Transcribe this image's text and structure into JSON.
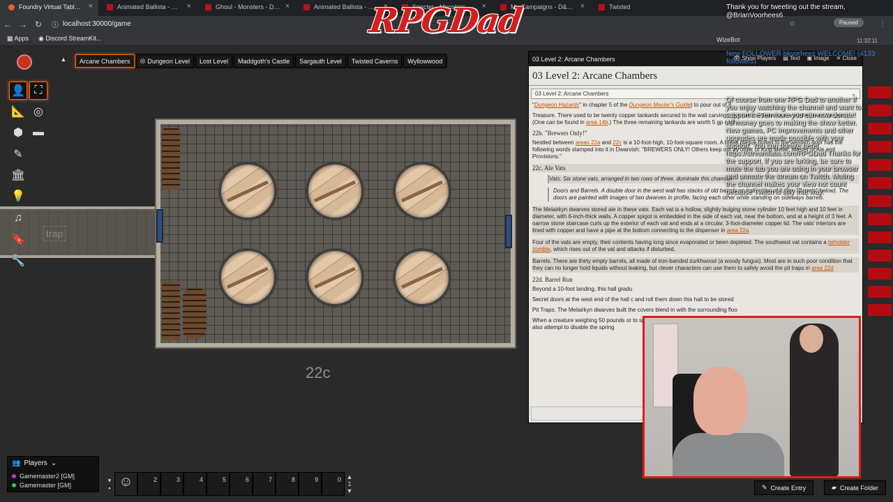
{
  "browser": {
    "tabs": [
      {
        "title": "Foundry Virtual Tabletop • A",
        "active": true
      },
      {
        "title": "Animated Ballista - Monste"
      },
      {
        "title": "Ghoul - Monsters - D&D Be"
      },
      {
        "title": "Animated Ballista - Monste"
      },
      {
        "title": "Specter - Monsters - D&D B"
      },
      {
        "title": "My Campaigns - D&D Beyo"
      },
      {
        "title": "Twisted"
      }
    ],
    "url": "localhost:30000/game",
    "bookmarks": [
      "Apps",
      "Discord StreamKit..."
    ],
    "profile_status": "Paused"
  },
  "overlay": {
    "logo": "RPGDad",
    "tweet": "Thank you for tweeting out the stream, @BrianVoorhees6.",
    "wizebot": "WizeBot",
    "clock": "11:32:11",
    "chat_message": "Of course from one RPG Dad to another If you enjoy watching the channel and want to support it even more you can now donate! All money goes to making the show better. New games, PC improvements and other upgrades are made possible with your support. You can donate here! https://streamlabs.com/RPGDad Thanks for the support. If you are lurking, be sure to mute the tab you are using in your browser and unmute the stream on Twitch. Muting the channel makes your view not count because Twitch is silly that way.",
    "follower_banner": "New FOLLOWER bkyorheez WELCOME! (4133 followers)"
  },
  "scene_nav": {
    "scenes": [
      {
        "label": "Arcane Chambers",
        "active": true
      },
      {
        "label": "Dungeon Level",
        "icon": "compass"
      },
      {
        "label": "Lost Level"
      },
      {
        "label": "Maddgoth's Castle"
      },
      {
        "label": "Sargauth Level"
      },
      {
        "label": "Twisted Caverns"
      },
      {
        "label": "Wyllowwood"
      }
    ]
  },
  "map": {
    "room_label": "22c",
    "trap_label": "trap"
  },
  "controls": [
    "token",
    "fullscreen",
    "measure",
    "target",
    "tiles",
    "draw",
    "walls",
    "lighting",
    "sounds",
    "notes",
    "settings"
  ],
  "players": {
    "header": "Players",
    "list": [
      {
        "name": "Gamemaster2 [GM]",
        "color": "#c43cc4"
      },
      {
        "name": "Gamemaster [GM]",
        "color": "#2ecc40"
      }
    ]
  },
  "hotbar": {
    "slots": [
      "1",
      "2",
      "3",
      "4",
      "5",
      "6",
      "7",
      "8",
      "9",
      "0"
    ],
    "page": "1"
  },
  "journal": {
    "window_title": "03 Level 2: Arcane Chambers",
    "heading": "03 Level 2: Arcane Chambers",
    "selected_page": "03 Level 2: Arcane Chambers",
    "header_buttons": [
      "Show Players",
      "Text",
      "Image",
      "Close"
    ],
    "para1_pre": "\"",
    "para1_link": "Dungeon Hazards",
    "para1_mid": "\" in chapter 5 of the ",
    "para1_link2": "Dungeon Master's Guide",
    "para1_post": ") to pour out of it.",
    "treasure": "Treasure. There used to be twenty copper tankards secured to the wall carvings, but most of them have vanished over the years. (One can be found in ",
    "treasure_link": "area 14b",
    "treasure_post": ".) The three remaining tankards are worth 5 gp each.",
    "h22b": "22b. \"Brewers Only!\"",
    "p22b_pre": "Nestled between ",
    "p22b_link1": "areas 22a",
    "p22b_and": " and ",
    "p22b_link2": "22c",
    "p22b_post": " is a 10-foot-high, 10-foot-square room. A brass plaque bolted to the western door has the following words stamped into it in Dwarvish: \"BREWERS ONLY! Others keep out by order of King Melair, Master of Ale and Provisions.\"",
    "h22c": "22c. Ale Vats",
    "q1": "Vats. Six stone vats, arranged in two rows of three, dominate this chamber.",
    "q2": "Doors and Barrels. A double door in the west wall has stacks of old barrels on both sides of it (see \"Barrels\" below). The doors are painted with images of two dwarves in profile, facing each other while standing on sideways barrels.",
    "p_vats": "The Melairkyn dwarves stored ale in these vats. Each vat is a hollow, slightly bulging stone cylinder 10 feet high and 10 feet in diameter, with 6-inch-thick walls. A copper spigot is embedded in the side of each vat, near the bottom, and at a height of 3 feet. A narrow stone staircase curls up the exterior of each vat and ends at a circular, 3-foot-diameter copper lid. The vats' interiors are lined with copper and have a pipe at the bottom connecting to the dispenser in ",
    "p_vats_link": "area 22a",
    "p_empty_pre": "Four of the vats are empty, their contents having long since evaporated or been depleted. The southwest vat contains a ",
    "p_empty_link": "beholder zombie",
    "p_empty_post": ", which rises out of the vat and attacks if disturbed.",
    "barrels": "Barrels. There are thirty empty barrels, all made of iron-banded zurkhwood (a woody fungus). Most are in such poor condition that they can no longer hold liquids without leaking, but clever characters can use them to safely avoid the pit traps in ",
    "barrels_link": "area 22d",
    "h22d": "22d. Barrel Run",
    "p22d": "Beyond a 10-foot landing, this hall gradu",
    "secret": "Secret doors at the west end of the hall c and roll them down this hall to be stored",
    "pit": "Pit Traps. The Melairkyn dwarves built the covers blend in with the surrounding floo",
    "creature": "When a creature weighing 50 pounds or to spill into the pit below and take 2d6 bl after the creature falls through. A succes pit can also attempt to disable the spring"
  },
  "buttons": {
    "create_entry": "Create Entry",
    "create_folder": "Create Folder"
  },
  "colors": {
    "accent": "#ff6400",
    "link": "#c44f00",
    "webcam_border": "#e01b1b",
    "logo": "#d41d1d"
  }
}
